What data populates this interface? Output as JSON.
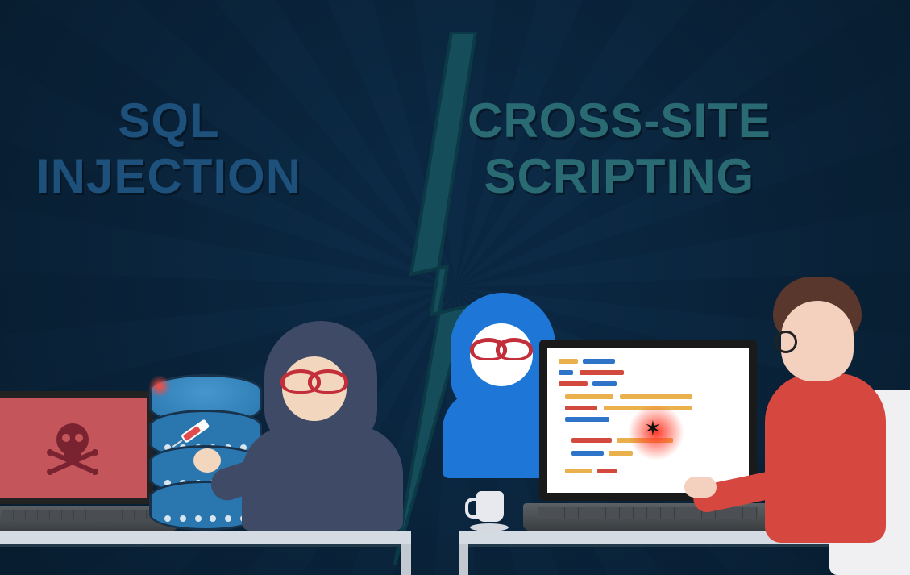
{
  "left": {
    "title": "SQL\nINJECTION"
  },
  "right": {
    "title": "CROSS-SITE\nSCRIPTING"
  }
}
